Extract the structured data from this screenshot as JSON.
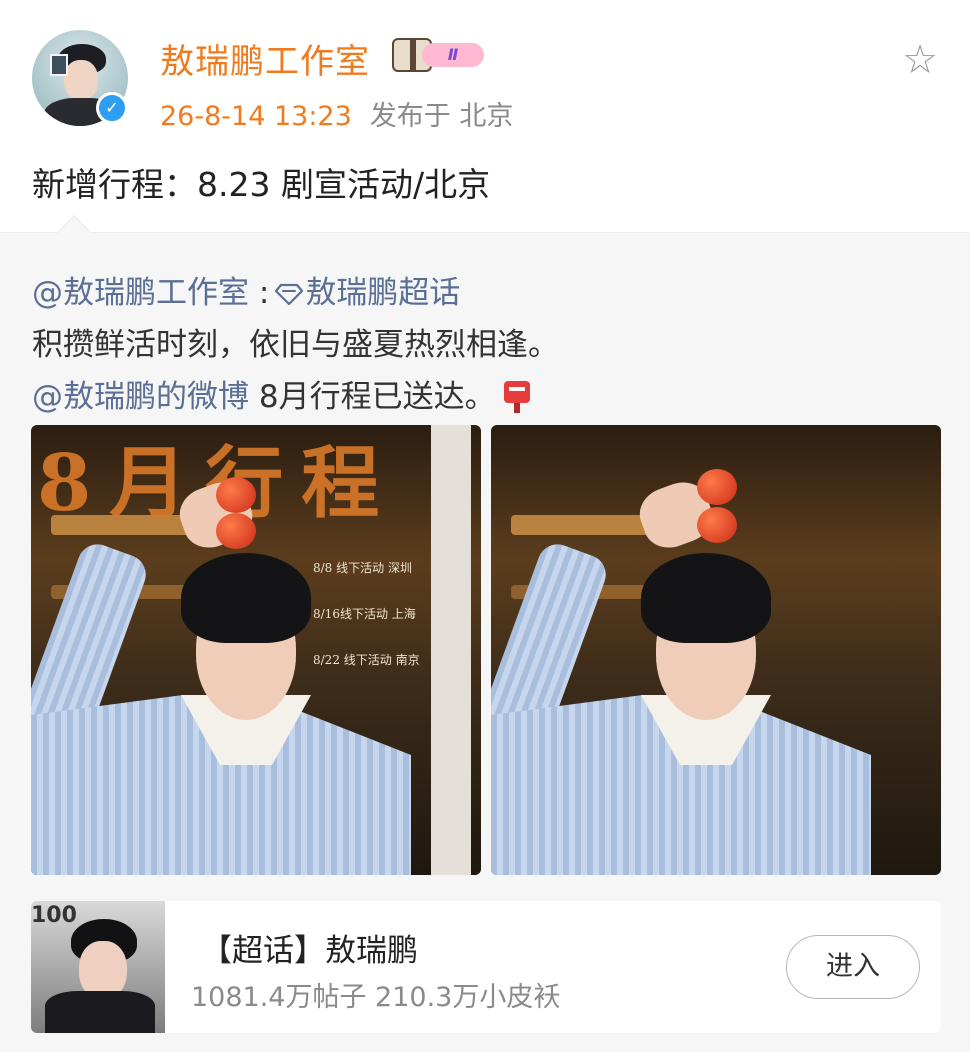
{
  "post": {
    "author": "敖瑞鹏工作室",
    "fan_level": "Ⅱ",
    "time": "26-8-14 13:23",
    "location": "发布于 北京",
    "text": "新增行程：8.23 剧宣活动/北京"
  },
  "repost": {
    "mention_author": "@敖瑞鹏工作室",
    "separator": " :",
    "topic_link": "敖瑞鹏超话",
    "line2": "积攒鲜活时刻，依旧与盛夏热烈相逢。",
    "mention_user": "@敖瑞鹏的微博",
    "line3_tail": " 8月行程已送达。",
    "images": {
      "poster_title": "8月行程",
      "schedule": [
        "8/8 线下活动  深圳",
        "8/16线下活动  上海",
        "8/22 线下活动  南京"
      ]
    }
  },
  "topic_card": {
    "title": "【超话】敖瑞鹏",
    "stats": "1081.4万帖子 210.3万小皮袄",
    "button": "进入",
    "thumb_text": "100"
  },
  "colors": {
    "author": "#f07b1e",
    "link": "#5b6f95",
    "verified": "#2e9ff0"
  },
  "icons": [
    "star-icon",
    "verified-icon",
    "diamond-icon",
    "mailbox-icon",
    "fan-badge-icon"
  ]
}
